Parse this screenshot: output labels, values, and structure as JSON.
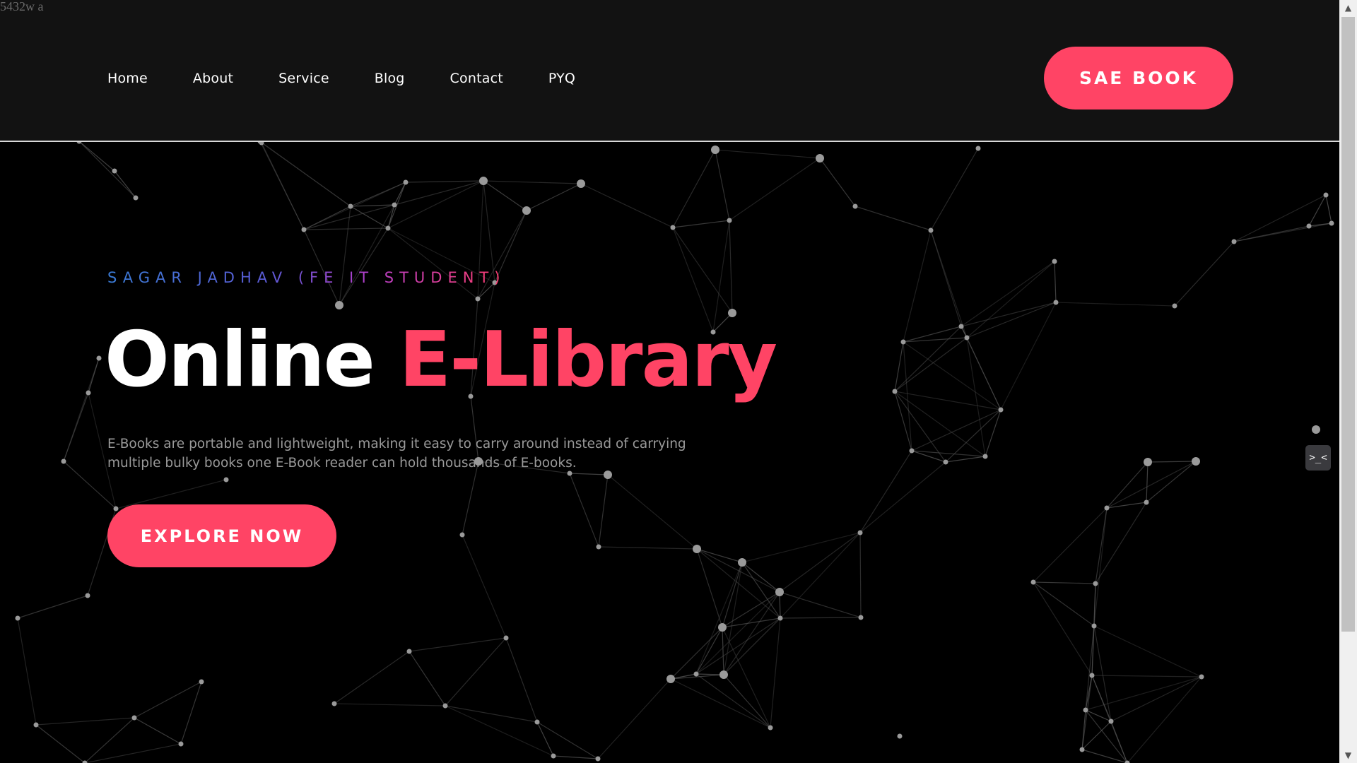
{
  "stray_text": "5432w a",
  "nav": {
    "items": [
      {
        "label": "Home"
      },
      {
        "label": "About"
      },
      {
        "label": "Service"
      },
      {
        "label": "Blog"
      },
      {
        "label": "Contact"
      },
      {
        "label": "PYQ"
      }
    ],
    "cta_label": "SAE BOOK"
  },
  "hero": {
    "kicker": "SAGAR JADHAV (FE IT STUDENT)",
    "title_part1": "Online",
    "title_part2": "E-Library",
    "description": "E-Books are portable and lightweight, making it easy to carry around instead of carrying multiple bulky books one E-Book reader can hold thousands of E-books.",
    "cta_label": "EXPLORE NOW"
  },
  "colors": {
    "accent": "#ff4465",
    "header_bg": "#121212",
    "page_bg": "#000000",
    "network_line": "#5a5a5a",
    "network_node": "#9a9a9a"
  },
  "widget": {
    "icon": "face-icon",
    "glyph": ">_<"
  },
  "scrollbar": {
    "up_glyph": "▲",
    "down_glyph": "▼"
  }
}
